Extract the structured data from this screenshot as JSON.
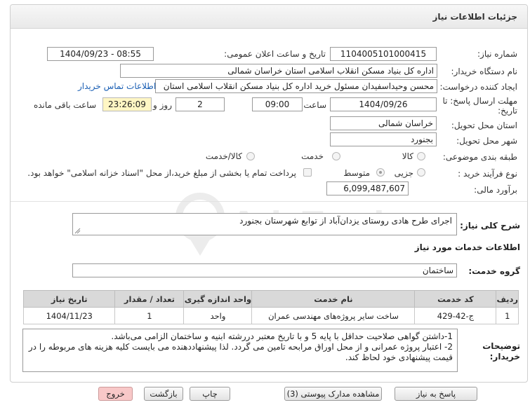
{
  "header": {
    "title": "جزئیات اطلاعات نیاز"
  },
  "form": {
    "need_number_label": "شماره نیاز:",
    "need_number": "1104005101000415",
    "announce_label": "تاریخ و ساعت اعلان عمومی:",
    "announce_value": "1404/09/23 - 08:55",
    "buyer_org_label": "نام دستگاه خریدار:",
    "buyer_org": "اداره کل بنیاد مسکن انقلاب اسلامی استان خراسان شمالی",
    "creator_label": "ایجاد کننده درخواست:",
    "creator": "محسن وحیداسفیدان مسئول خرید اداره کل بنیاد مسکن انقلاب اسلامی استان",
    "contact_link": "اطلاعات تماس خریدار",
    "deadline_label_line1": "مهلت ارسال پاسخ: تا",
    "deadline_label_line2": "تاریخ:",
    "deadline_date": "1404/09/26",
    "time_label": "ساعت",
    "deadline_time": "09:00",
    "days_value": "2",
    "days_label": "روز و",
    "remaining_time": "23:26:09",
    "remaining_label": "ساعت باقی مانده",
    "province_label": "استان محل تحویل:",
    "province": "خراسان شمالی",
    "city_label": "شهر محل تحویل:",
    "city": "بجنورد",
    "category_label": "طبقه بندی موضوعی:",
    "category_options": [
      "کالا",
      "خدمت",
      "کالا/خدمت"
    ],
    "process_label": "نوع فرآیند خرید :",
    "process_options": [
      "جزیی",
      "متوسط"
    ],
    "payment_note": "پرداخت تمام یا بخشی از مبلغ خرید،از محل \"اسناد خزانه اسلامی\" خواهد بود.",
    "estimate_label": "برآورد مالی:",
    "estimate": "6,099,487,607"
  },
  "description": {
    "label": "شرح کلی نیاز:",
    "text": "اجرای طرح هادی روستای یزدان‌آباد از توابع شهرستان بجنورد"
  },
  "services": {
    "section_title": "اطلاعات خدمات مورد نیاز",
    "group_label": "گروه خدمت:",
    "group_value": "ساختمان",
    "columns": [
      "ردیف",
      "کد خدمت",
      "نام خدمت",
      "واحد اندازه گیری",
      "تعداد / مقدار",
      "تاریخ نیاز"
    ],
    "rows": [
      [
        "1",
        "ج-42-429",
        "ساخت سایر پروژه‌های مهندسی عمران",
        "واحد",
        "1",
        "1404/11/23"
      ]
    ]
  },
  "buyer_notes": {
    "label_line1": "توضیحات",
    "label_line2": "خریدار:",
    "line1": "1-داشتن گواهی صلاحیت حداقل با پایه 5 و با تاریخ معتبر دررشته ابنیه و ساختمان الزامی می‌باشد.",
    "line2": "2- اعتبار پروژه عمرانی و از محل اوراق مرابحه تامین می گردد. لذا پیشنهاددهنده می بایست کلیه هزینه های مربوطه را در",
    "line3": "قیمت پیشنهادی خود لحاظ کند."
  },
  "buttons": {
    "reply": "پاسخ به نیاز",
    "docs": "مشاهده مدارک پیوستی (3)",
    "print": "چاپ",
    "back": "بازگشت",
    "exit": "خروج"
  },
  "watermark": {
    "text": "AriaTender.neT"
  },
  "colors": {
    "link": "#1a5fb4",
    "highlight": "#fff6c4",
    "exit_button": "#f8c8c8",
    "table_header": "#d9d9d9"
  }
}
